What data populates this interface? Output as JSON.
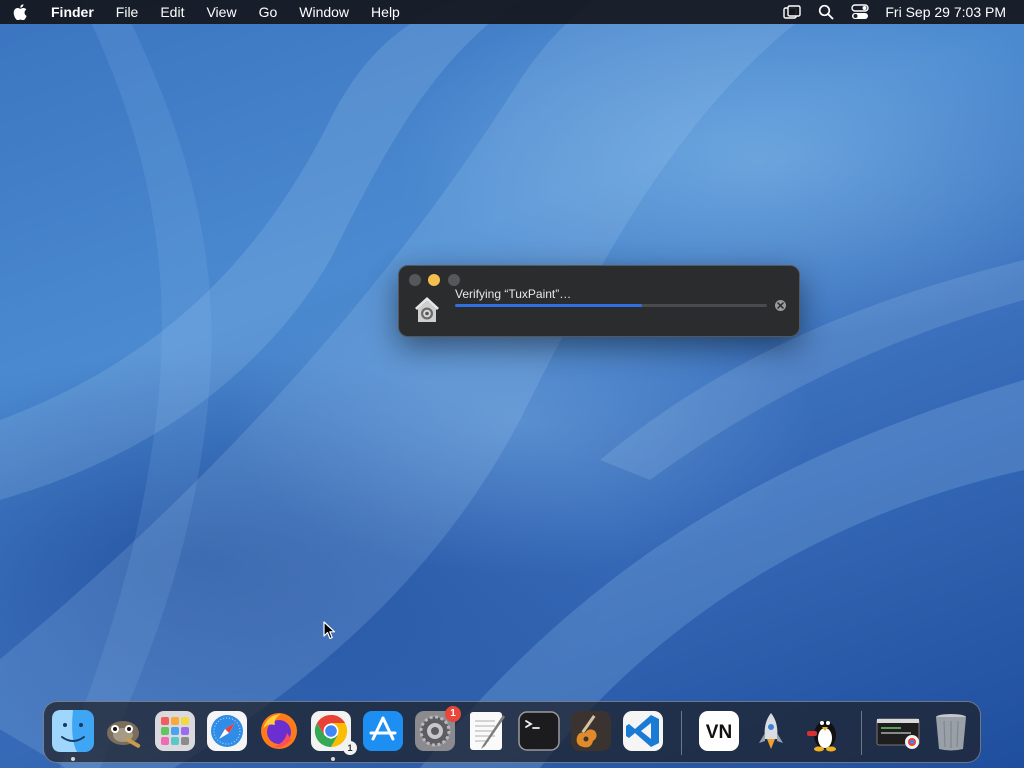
{
  "menubar": {
    "app_name": "Finder",
    "menus": [
      "File",
      "Edit",
      "View",
      "Go",
      "Window",
      "Help"
    ],
    "clock": "Fri Sep 29  7:03 PM",
    "status_icons": [
      "display-icon",
      "search-icon",
      "control-center-icon"
    ]
  },
  "dialog": {
    "title": "Verifying “TuxPaint”…",
    "progress": 0.6,
    "accent": "#2f6fe0"
  },
  "dock": {
    "items": [
      {
        "name": "finder",
        "running": true
      },
      {
        "name": "gimp",
        "running": false
      },
      {
        "name": "launchpad",
        "running": false
      },
      {
        "name": "safari",
        "running": false
      },
      {
        "name": "firefox",
        "running": false
      },
      {
        "name": "chrome",
        "running": true,
        "badge": "1"
      },
      {
        "name": "app-store",
        "running": false
      },
      {
        "name": "system-settings",
        "running": false,
        "badge": "1"
      },
      {
        "name": "textedit",
        "running": false
      },
      {
        "name": "terminal",
        "running": false
      },
      {
        "name": "garageband",
        "running": false
      },
      {
        "name": "vscode",
        "running": false
      },
      {
        "name": "vnc-viewer",
        "running": false,
        "label": "VN"
      },
      {
        "name": "rocket",
        "running": false
      },
      {
        "name": "tuxpaint",
        "running": false
      },
      {
        "name": "chrome-window-thumbnail",
        "running": false
      },
      {
        "name": "trash",
        "running": false
      }
    ]
  }
}
